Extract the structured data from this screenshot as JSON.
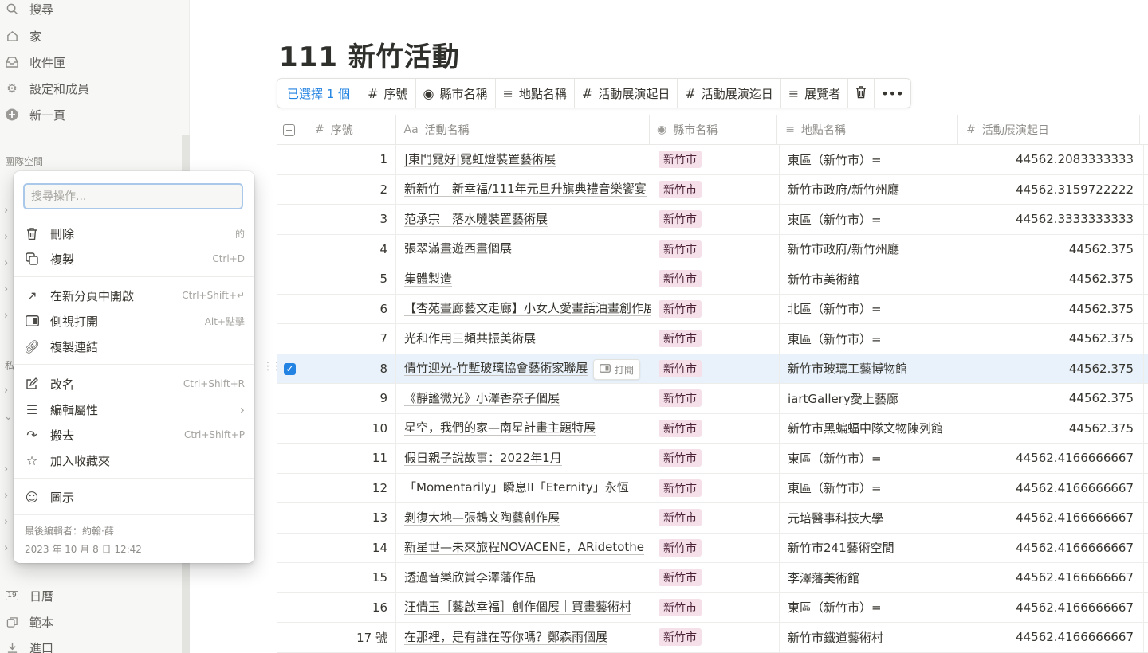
{
  "sidebar": {
    "items": [
      {
        "label": "搜尋",
        "icon": "search-icon"
      },
      {
        "label": "家",
        "icon": "home-icon"
      },
      {
        "label": "收件匣",
        "icon": "inbox-icon"
      },
      {
        "label": "設定和成員",
        "icon": "gear-icon"
      },
      {
        "label": "新一頁",
        "icon": "plus-circle-icon"
      }
    ],
    "section_team": "團隊空間",
    "section_private": "私",
    "bottom_items": [
      {
        "label": "日曆",
        "icon": "calendar-icon",
        "icon_text": "19"
      },
      {
        "label": "範本",
        "icon": "template-icon"
      },
      {
        "label": "進口",
        "icon": "import-icon"
      }
    ]
  },
  "page": {
    "title": "111 新竹活動"
  },
  "toolbar": {
    "selected": "已選擇 1 個",
    "props": [
      {
        "icon": "#",
        "label": "序號"
      },
      {
        "icon": "◉",
        "label": "縣市名稱"
      },
      {
        "icon": "≡",
        "label": "地點名稱"
      },
      {
        "icon": "#",
        "label": "活動展演起日"
      },
      {
        "icon": "#",
        "label": "活動展演迄日"
      },
      {
        "icon": "≡",
        "label": "展覽者"
      }
    ]
  },
  "table": {
    "headers": [
      {
        "icon": "#",
        "label": "序號"
      },
      {
        "icon": "Aa",
        "label": "活動名稱"
      },
      {
        "icon": "◉",
        "label": "縣市名稱"
      },
      {
        "icon": "≡",
        "label": "地點名稱"
      },
      {
        "icon": "#",
        "label": "活動展演起日"
      }
    ],
    "rows": [
      {
        "no": "1",
        "name": "|東門霓好|霓虹燈裝置藝術展",
        "city": "新竹市",
        "place": "東區（新竹市）=",
        "start": "44562.2083333333"
      },
      {
        "no": "2",
        "name": "新新竹｜新幸福/111年元旦升旗典禮音樂饗宴",
        "city": "新竹市",
        "place": "新竹市政府/新竹州廳",
        "start": "44562.3159722222"
      },
      {
        "no": "3",
        "name": "范承宗｜落水噠裝置藝術展",
        "city": "新竹市",
        "place": "東區（新竹市）=",
        "start": "44562.3333333333"
      },
      {
        "no": "4",
        "name": "張翠滿畫遊西畫個展",
        "city": "新竹市",
        "place": "新竹市政府/新竹州廳",
        "start": "44562.375"
      },
      {
        "no": "5",
        "name": "集體製造",
        "city": "新竹市",
        "place": "新竹市美術館",
        "start": "44562.375"
      },
      {
        "no": "6",
        "name": "【杏苑畫廊藝文走廊】小女人愛畫話油畫創作展",
        "city": "新竹市",
        "place": "北區（新竹市）=",
        "start": "44562.375"
      },
      {
        "no": "7",
        "name": "光和作用三頻共振美術展",
        "city": "新竹市",
        "place": "東區（新竹市）=",
        "start": "44562.375"
      },
      {
        "no": "8",
        "name": "倩竹迎光-竹塹玻璃協會藝術家聯展",
        "city": "新竹市",
        "place": "新竹市玻璃工藝博物館",
        "start": "44562.375",
        "selected": true
      },
      {
        "no": "9",
        "name": "《靜謐微光》小澤香奈子個展",
        "city": "新竹市",
        "place": "iartGallery愛上藝廊",
        "start": "44562.375"
      },
      {
        "no": "10",
        "name": "星空，我們的家—南星計畫主題特展",
        "city": "新竹市",
        "place": "新竹市黑蝙蝠中隊文物陳列館",
        "start": "44562.375"
      },
      {
        "no": "11",
        "name": "假日親子說故事：2022年1月",
        "city": "新竹市",
        "place": "東區（新竹市）=",
        "start": "44562.4166666667"
      },
      {
        "no": "12",
        "name": "「Momentarily」瞬息II「Eternity」永恆",
        "city": "新竹市",
        "place": "東區（新竹市）=",
        "start": "44562.4166666667"
      },
      {
        "no": "13",
        "name": "剝復大地—張鶴文陶藝創作展",
        "city": "新竹市",
        "place": "元培醫事科技大學",
        "start": "44562.4166666667"
      },
      {
        "no": "14",
        "name": "新星世—未來旅程NOVACENE，ARidetothe",
        "city": "新竹市",
        "place": "新竹市241藝術空間",
        "start": "44562.4166666667"
      },
      {
        "no": "15",
        "name": "透過音樂欣賞李澤藩作品",
        "city": "新竹市",
        "place": "李澤藩美術館",
        "start": "44562.4166666667"
      },
      {
        "no": "16",
        "name": "汪倩玉［藝啟幸福］創作個展｜買畫藝術村",
        "city": "新竹市",
        "place": "東區（新竹市）=",
        "start": "44562.4166666667"
      },
      {
        "no": "17 號",
        "name": "在那裡，是有誰在等你嗎？鄭森雨個展",
        "city": "新竹市",
        "place": "新竹市鐵道藝術村",
        "start": "44562.4166666667"
      }
    ],
    "open_button": "打開"
  },
  "menu": {
    "search_placeholder": "搜尋操作...",
    "items": [
      {
        "label": "刪除",
        "shortcut": "的",
        "icon": "trash-icon"
      },
      {
        "label": "複製",
        "shortcut": "Ctrl+D",
        "icon": "duplicate-icon"
      },
      {
        "label": "在新分頁中開啟",
        "shortcut": "Ctrl+Shift+↵",
        "icon": "open-new-tab-icon"
      },
      {
        "label": "側視打開",
        "shortcut": "Alt+點擊",
        "icon": "side-peek-icon"
      },
      {
        "label": "複製連結",
        "shortcut": "",
        "icon": "link-icon"
      },
      {
        "label": "改名",
        "shortcut": "Ctrl+Shift+R",
        "icon": "rename-icon"
      },
      {
        "label": "編輯屬性",
        "shortcut": "›",
        "icon": "list-icon"
      },
      {
        "label": "搬去",
        "shortcut": "Ctrl+Shift+P",
        "icon": "move-icon"
      },
      {
        "label": "加入收藏夾",
        "shortcut": "",
        "icon": "star-icon"
      },
      {
        "label": "圖示",
        "shortcut": "",
        "icon": "smiley-icon"
      }
    ],
    "footer_editor": "最後編輯者：約翰·薛",
    "footer_time": "2023 年 10 月 8 日 12:42"
  },
  "colors": {
    "accent": "#2383e2",
    "tag_bg": "#f5e0e9",
    "selected_row": "#e9f2fb"
  }
}
